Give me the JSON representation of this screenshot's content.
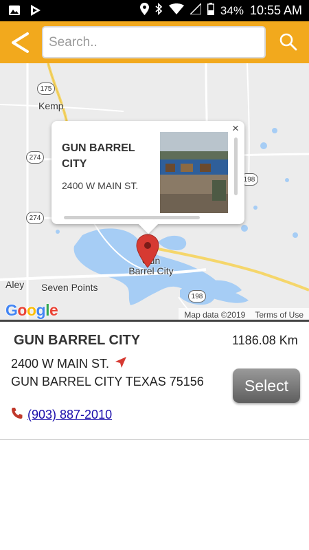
{
  "status_bar": {
    "battery": "34%",
    "time": "10:55 AM",
    "icons": [
      "image-icon",
      "play-store-icon",
      "location-icon",
      "bluetooth-icon",
      "wifi-icon",
      "signal-icon",
      "battery-icon"
    ]
  },
  "toolbar": {
    "back_icon": "back-chevron-icon",
    "search_placeholder": "Search..",
    "search_icon": "search-icon",
    "accent": "#f2a91d"
  },
  "map": {
    "labels": {
      "kemp": "Kemp",
      "aley": "Aley",
      "seven_points": "Seven Points",
      "gun_barrel_city_map": "Gun\nBarrel City"
    },
    "shields": {
      "s175": "175",
      "s274a": "274",
      "s274b": "274",
      "s198a": "198",
      "s198b": "198"
    },
    "google_logo": "Google",
    "map_data": "Map data ©2019",
    "terms": "Terms of Use",
    "info_window": {
      "title": "GUN BARREL CITY",
      "address": "2400 W MAIN ST.",
      "close": "×"
    }
  },
  "location": {
    "name": "GUN BARREL CITY",
    "address": "2400 W MAIN ST.",
    "city_state_zip": "GUN BARREL CITY  TEXAS 75156",
    "phone": "(903) 887-2010",
    "distance": "1186.08 Km",
    "select_label": "Select",
    "navigate_icon": "navigation-arrow-icon",
    "phone_icon": "phone-icon"
  },
  "colors": {
    "water": "#a6cdf5",
    "link": "#1a0dab",
    "marker": "#d63a32"
  }
}
